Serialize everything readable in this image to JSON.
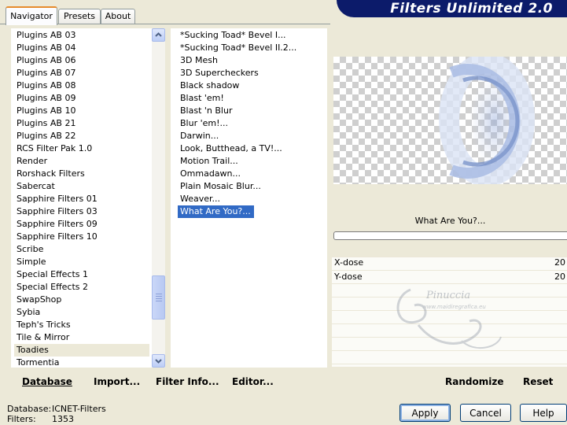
{
  "tabs": [
    "Navigator",
    "Presets",
    "About"
  ],
  "header": {
    "title": "Filters Unlimited 2.0"
  },
  "categories": {
    "items": [
      "Plugins AB 03",
      "Plugins AB 04",
      "Plugins AB 06",
      "Plugins AB 07",
      "Plugins AB 08",
      "Plugins AB 09",
      "Plugins AB 10",
      "Plugins AB 21",
      "Plugins AB 22",
      "RCS Filter Pak 1.0",
      "Render",
      "Rorshack Filters",
      "Sabercat",
      "Sapphire Filters 01",
      "Sapphire Filters 03",
      "Sapphire Filters 09",
      "Sapphire Filters 10",
      "Scribe",
      "Simple",
      "Special Effects 1",
      "Special Effects 2",
      "SwapShop",
      "Sybia",
      "Teph's Tricks",
      "Tile & Mirror",
      "Toadies",
      "Tormentia"
    ],
    "selected": "Toadies"
  },
  "filters": {
    "items": [
      "*Sucking Toad*  Bevel I...",
      "*Sucking Toad*  Bevel II.2...",
      "3D Mesh",
      "3D Supercheckers",
      "Black shadow",
      "Blast 'em!",
      "Blast 'n Blur",
      "Blur 'em!...",
      "Darwin...",
      "Look, Butthead, a TV!...",
      "Motion Trail...",
      "Ommadawn...",
      "Plain Mosaic Blur...",
      "Weaver...",
      "What Are You?..."
    ],
    "selected": "What Are You?..."
  },
  "preview": {
    "filter_name": "What Are You?..."
  },
  "params": [
    {
      "label": "X-dose",
      "value": "20"
    },
    {
      "label": "Y-dose",
      "value": "20"
    }
  ],
  "watermark": {
    "text": "Pinuccia",
    "subtext": "www.maidiregrafica.eu"
  },
  "toolbar": {
    "database": "Database",
    "import": "Import...",
    "filter_info": "Filter Info...",
    "editor": "Editor...",
    "randomize": "Randomize",
    "reset": "Reset"
  },
  "status": {
    "database_label": "Database:",
    "database_value": "ICNET-Filters",
    "filters_label": "Filters:",
    "filters_value": "1353"
  },
  "buttons": {
    "apply": "Apply",
    "cancel": "Cancel",
    "help": "Help"
  }
}
